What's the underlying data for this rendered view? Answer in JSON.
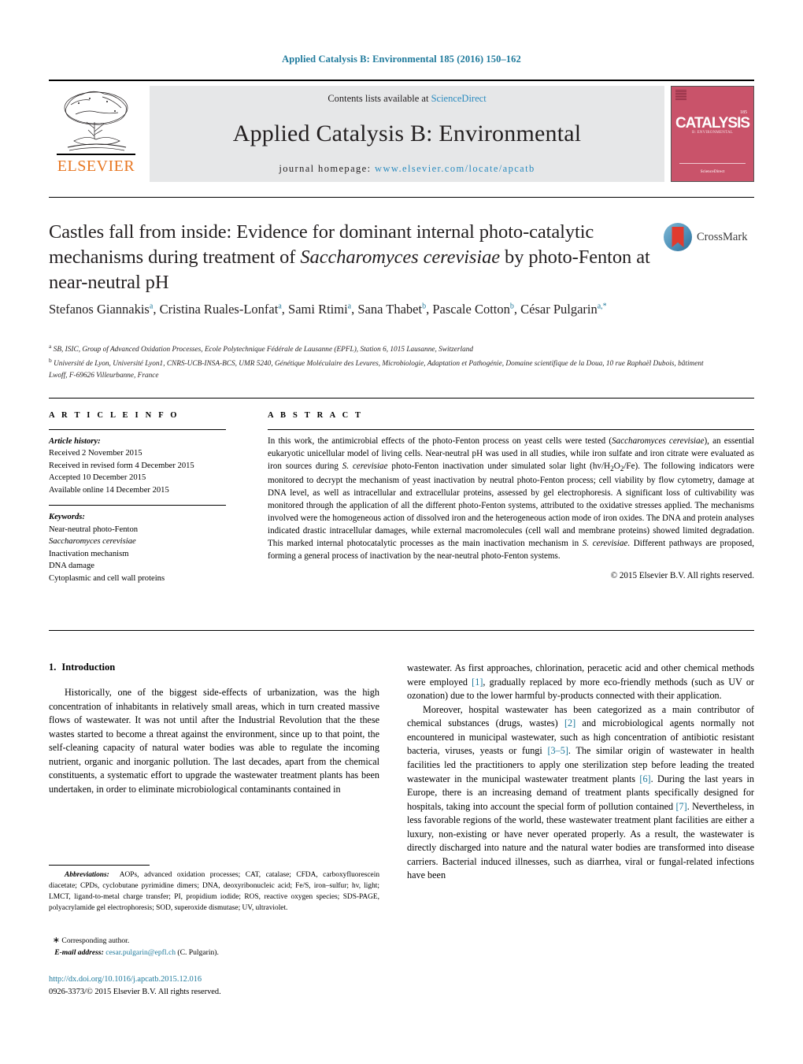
{
  "running_head": "Applied Catalysis B: Environmental 185 (2016) 150–162",
  "masthead": {
    "contents_prefix": "Contents lists available at ",
    "sciencedirect": "ScienceDirect",
    "journal_title": "Applied Catalysis B: Environmental",
    "homepage_prefix": "journal homepage: ",
    "homepage_url": "www.elsevier.com/locate/apcatb",
    "publisher": "ELSEVIER",
    "cover": {
      "title": "CATALYSIS",
      "subtitle": "B: ENVIRONMENTAL",
      "volume": "185",
      "footer": "ScienceDirect"
    }
  },
  "article": {
    "title_part1": "Castles fall from inside: Evidence for dominant internal photo-catalytic mechanisms during treatment of ",
    "title_italic1": "Saccharomyces cerevisiae",
    "title_part2": " by photo-Fenton at near-neutral pH",
    "crossmark_label": "CrossMark",
    "authors": [
      {
        "name": "Stefanos Giannakis",
        "sup": "a",
        "sep": ", "
      },
      {
        "name": "Cristina Ruales-Lonfat",
        "sup": "a",
        "sep": ", "
      },
      {
        "name": "Sami Rtimi",
        "sup": "a",
        "sep": ", "
      },
      {
        "name": "Sana Thabet",
        "sup": "b",
        "sep": ", "
      },
      {
        "name": "Pascale Cotton",
        "sup": "b",
        "sep": ","
      },
      {
        "name": "César Pulgarin",
        "sup": "a,*",
        "sep": ""
      }
    ],
    "affiliations": [
      {
        "sup": "a",
        "text": "SB, ISIC, Group of Advanced Oxidation Processes, Ecole Polytechnique Fédérale de Lausanne (EPFL), Station 6, 1015 Lausanne, Switzerland"
      },
      {
        "sup": "b",
        "text": "Université de Lyon, Université Lyon1, CNRS-UCB-INSA-BCS, UMR 5240, Génétique Moléculaire des Levures, Microbiologie, Adaptation et Pathogénie, Domaine scientifique de la Doua, 10 rue Raphaël Dubois, bâtiment Lwoff, F-69626 Villeurbanne, France"
      }
    ]
  },
  "article_info": {
    "heading": "A R T I C L E   I N F O",
    "history_label": "Article history:",
    "history": [
      "Received 2 November 2015",
      "Received in revised form 4 December 2015",
      "Accepted 10 December 2015",
      "Available online 14 December 2015"
    ],
    "keywords_label": "Keywords:",
    "keywords": [
      {
        "text": "Near-neutral photo-Fenton",
        "italic": false
      },
      {
        "text": "Saccharomyces cerevisiae",
        "italic": true
      },
      {
        "text": "Inactivation mechanism",
        "italic": false
      },
      {
        "text": "DNA damage",
        "italic": false
      },
      {
        "text": "Cytoplasmic and cell wall proteins",
        "italic": false
      }
    ]
  },
  "abstract": {
    "heading": "A B S T R A C T",
    "p1_a": "In this work, the antimicrobial effects of the photo-Fenton process on yeast cells were tested (",
    "p1_i1": "Saccharomyces cerevisiae",
    "p1_b": "), an essential eukaryotic unicellular model of living cells. Near-neutral pH was used in all studies, while iron sulfate and iron citrate were evaluated as iron sources during ",
    "p1_i2": "S. cerevisiae",
    "p1_c": " photo-Fenton inactivation under simulated solar light (hv/H",
    "p1_sub1": "2",
    "p1_d": "O",
    "p1_sub2": "2",
    "p1_e": "/Fe). The following indicators were monitored to decrypt the mechanism of yeast inactivation by neutral photo-Fenton process; cell viability by flow cytometry, damage at DNA level, as well as intracellular and extracellular proteins, assessed by gel electrophoresis. A significant loss of cultivability was monitored through the application of all the different photo-Fenton systems, attributed to the oxidative stresses applied. The mechanisms involved were the homogeneous action of dissolved iron and the heterogeneous action mode of iron oxides. The DNA and protein analyses indicated drastic intracellular damages, while external macromolecules (cell wall and membrane proteins) showed limited degradation. This marked internal photocatalytic processes as the main inactivation mechanism in ",
    "p1_i3": "S. cerevisiae",
    "p1_f": ". Different pathways are proposed, forming a general process of inactivation by the near-neutral photo-Fenton systems.",
    "copyright": "© 2015 Elsevier B.V. All rights reserved."
  },
  "introduction": {
    "number": "1.",
    "title": "Introduction",
    "left_p1": "Historically, one of the biggest side-effects of urbanization, was the high concentration of inhabitants in relatively small areas, which in turn created massive flows of wastewater. It was not until after the Industrial Revolution that the these wastes started to become a threat against the environment, since up to that point, the self-cleaning capacity of natural water bodies was able to regulate the incoming nutrient, organic and inorganic pollution. The last decades, apart from the chemical constituents, a systematic effort to upgrade the wastewater treatment plants has been undertaken, in order to eliminate microbiological contaminants contained in",
    "right_p1_a": "wastewater. As first approaches, chlorination, peracetic acid and other chemical methods were employed ",
    "right_p1_ref1": "[1]",
    "right_p1_b": ", gradually replaced by more eco-friendly methods (such as UV or ozonation) due to the lower harmful by-products connected with their application.",
    "right_p2_a": "Moreover, hospital wastewater has been categorized as a main contributor of chemical substances (drugs, wastes) ",
    "right_p2_ref1": "[2]",
    "right_p2_b": " and microbiological agents normally not encountered in municipal wastewater, such as high concentration of antibiotic resistant bacteria, viruses, yeasts or fungi ",
    "right_p2_ref2": "[3–5]",
    "right_p2_c": ". The similar origin of wastewater in health facilities led the practitioners to apply one sterilization step before leading the treated wastewater in the municipal wastewater treatment plants ",
    "right_p2_ref3": "[6]",
    "right_p2_d": ". During the last years in Europe, there is an increasing demand of treatment plants specifically designed for hospitals, taking into account the special form of pollution contained ",
    "right_p2_ref4": "[7]",
    "right_p2_e": ". Nevertheless, in less favorable regions of the world, these wastewater treatment plant facilities are either a luxury, non-existing or have never operated properly. As a result, the wastewater is directly discharged into nature and the natural water bodies are transformed into disease carriers. Bacterial induced illnesses, such as diarrhea, viral or fungal-related infections have been"
  },
  "footnotes": {
    "abbrev_label": "Abbreviations:",
    "abbrev_text": "AOPs, advanced oxidation processes; CAT, catalase; CFDA, carboxyfluorescein diacetate; CPDs, cyclobutane pyrimidine dimers; DNA, deoxyribonucleic acid; Fe/S, iron–sulfur; hv, light; LMCT, ligand-to-metal charge transfer; PI, propidium iodide; ROS, reactive oxygen species; SDS-PAGE, polyacrylamide gel electrophoresis; SOD, superoxide dismutase; UV, ultraviolet.",
    "corresponding": "Corresponding author.",
    "email_label": "E-mail address:",
    "email": "cesar.pulgarin@epfl.ch",
    "email_suffix": " (C. Pulgarin)."
  },
  "footer": {
    "doi": "http://dx.doi.org/10.1016/j.apcatb.2015.12.016",
    "issn_line": "0926-3373/© 2015 Elsevier B.V. All rights reserved."
  },
  "colors": {
    "link": "#1f7a9c",
    "sciencedirect": "#2b8bbf",
    "elsevier_orange": "#E87722",
    "cover_pink": "#c9536a"
  }
}
